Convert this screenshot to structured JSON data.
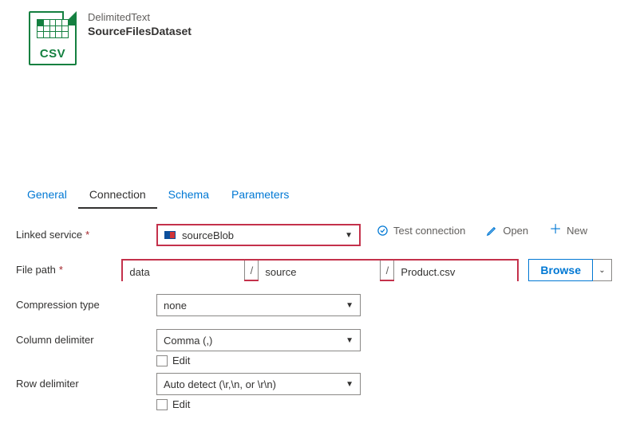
{
  "header": {
    "type": "DelimitedText",
    "name": "SourceFilesDataset",
    "icon_label": "CSV"
  },
  "tabs": {
    "general": "General",
    "connection": "Connection",
    "schema": "Schema",
    "parameters": "Parameters"
  },
  "form": {
    "linked_service": {
      "label": "Linked service",
      "required": "*",
      "value": "sourceBlob",
      "test_connection": "Test connection",
      "open": "Open",
      "new": "New"
    },
    "file_path": {
      "label": "File path",
      "required": "*",
      "container": "data",
      "directory": "source",
      "file": "Product.csv",
      "browse": "Browse"
    },
    "compression": {
      "label": "Compression type",
      "value": "none"
    },
    "column_delimiter": {
      "label": "Column delimiter",
      "value": "Comma (,)",
      "edit": "Edit"
    },
    "row_delimiter": {
      "label": "Row delimiter",
      "value": "Auto detect (\\r,\\n, or \\r\\n)",
      "edit": "Edit"
    }
  }
}
